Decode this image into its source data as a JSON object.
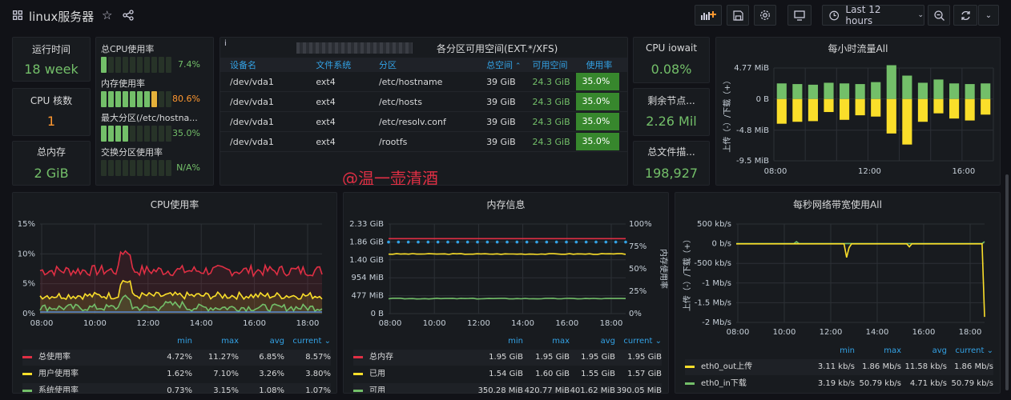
{
  "header": {
    "title": "linux服务器",
    "time_range": "Last 12 hours"
  },
  "stats": {
    "uptime": {
      "title": "运行时间",
      "value": "18 week"
    },
    "cpu_cores": {
      "title": "CPU 核数",
      "value": "1"
    },
    "total_mem": {
      "title": "总内存",
      "value": "2 GiB"
    },
    "iowait": {
      "title": "CPU iowait",
      "value": "0.08%"
    },
    "free_inodes": {
      "title": "剩余节点...",
      "value": "2.26 Mil"
    },
    "total_fd": {
      "title": "总文件描...",
      "value": "198,927"
    }
  },
  "gauges": [
    {
      "label": "总CPU使用率",
      "value": "7.4%",
      "fraction": 0.074,
      "color": "#73bf69"
    },
    {
      "label": "内存使用率",
      "value": "80.6%",
      "fraction": 0.806,
      "color": "#ff9830"
    },
    {
      "label": "最大分区(/etc/hostna...",
      "value": "35.0%",
      "fraction": 0.35,
      "color": "#73bf69"
    },
    {
      "label": "交换分区使用率",
      "value": "N/A%",
      "fraction": 0,
      "color": "#73bf69"
    }
  ],
  "partition_table": {
    "title": "各分区可用空间(EXT.*/XFS)",
    "columns": [
      "设备名",
      "文件系统",
      "分区",
      "总空间",
      "可用空间",
      "使用率"
    ],
    "rows": [
      [
        "/dev/vda1",
        "ext4",
        "/etc/hostname",
        "39 GiB",
        "24.3 GiB",
        "35.0%"
      ],
      [
        "/dev/vda1",
        "ext4",
        "/etc/hosts",
        "39 GiB",
        "24.3 GiB",
        "35.0%"
      ],
      [
        "/dev/vda1",
        "ext4",
        "/etc/resolv.conf",
        "39 GiB",
        "24.3 GiB",
        "35.0%"
      ],
      [
        "/dev/vda1",
        "ext4",
        "/rootfs",
        "39 GiB",
        "24.3 GiB",
        "35.0%"
      ]
    ]
  },
  "watermark": "@温一壶清酒",
  "chart_data": [
    {
      "type": "bar",
      "title": "每小时流量All",
      "ylabel": "上传（-）/下载（+）",
      "y_ticks": [
        "4.77 MiB",
        "0 B",
        "-4.8 MiB",
        "-9.5 MiB"
      ],
      "x_ticks": [
        "08:00",
        "12:00",
        "16:00"
      ],
      "ylim": [
        -9.5,
        4.77
      ],
      "series": [
        {
          "values": [
            2.4,
            2.3,
            2.2,
            2.5,
            2.4,
            2.3,
            2.6,
            5.2,
            3.6,
            2.5,
            3.0,
            2.4,
            2.3,
            2.4
          ],
          "color": "#73bf69"
        },
        {
          "values": [
            -3.8,
            -3.5,
            -3.4,
            -2.0,
            -3.2,
            -2.5,
            -2.7,
            -5.3,
            -7.0,
            -3.5,
            -2.2,
            -3.0,
            -3.3,
            -2.4
          ],
          "color": "#fade2a"
        }
      ]
    },
    {
      "type": "line",
      "title": "CPU使用率",
      "y_ticks": [
        "15%",
        "10%",
        "5%",
        "0%"
      ],
      "ylim": [
        0,
        15
      ],
      "x_ticks": [
        "08:00",
        "10:00",
        "12:00",
        "14:00",
        "16:00",
        "18:00"
      ],
      "series": [
        {
          "name": "总使用率",
          "color": "#e02f44",
          "min": "4.72%",
          "max": "11.27%",
          "avg": "6.85%",
          "current": "8.57%"
        },
        {
          "name": "用户使用率",
          "color": "#fade2a",
          "min": "1.62%",
          "max": "7.10%",
          "avg": "3.26%",
          "current": "3.80%"
        },
        {
          "name": "系统使用率",
          "color": "#73bf69",
          "min": "0.73%",
          "max": "3.15%",
          "avg": "1.08%",
          "current": "1.07%"
        }
      ],
      "legend_headers": [
        "min",
        "max",
        "avg",
        "current"
      ]
    },
    {
      "type": "line",
      "title": "内存信息",
      "y_ticks": [
        "2.33 GiB",
        "1.86 GiB",
        "1.40 GiB",
        "954 MiB",
        "477 MiB",
        "0 B"
      ],
      "y2_ticks": [
        "100%",
        "75%",
        "50%",
        "25%",
        "0%"
      ],
      "y2label": "内存使用率",
      "x_ticks": [
        "08:00",
        "10:00",
        "12:00",
        "14:00",
        "16:00",
        "18:00"
      ],
      "series": [
        {
          "name": "总内存",
          "color": "#e02f44",
          "min": "1.95 GiB",
          "max": "1.95 GiB",
          "avg": "1.95 GiB",
          "current": "1.95 GiB"
        },
        {
          "name": "已用",
          "color": "#fade2a",
          "min": "1.54 GiB",
          "max": "1.60 GiB",
          "avg": "1.55 GiB",
          "current": "1.57 GiB"
        },
        {
          "name": "可用",
          "color": "#73bf69",
          "min": "350.28 MiB",
          "max": "420.77 MiB",
          "avg": "401.62 MiB",
          "current": "390.05 MiB"
        }
      ],
      "legend_headers": [
        "min",
        "max",
        "avg",
        "current"
      ]
    },
    {
      "type": "line",
      "title": "每秒网络带宽使用All",
      "ylabel": "上传（-）/下载（+）",
      "y_ticks": [
        "500 kb/s",
        "0 b/s",
        "-500 kb/s",
        "-1 Mb/s",
        "-1.5 Mb/s",
        "-2 Mb/s"
      ],
      "x_ticks": [
        "08:00",
        "10:00",
        "12:00",
        "14:00",
        "16:00",
        "18:00"
      ],
      "series": [
        {
          "name": "eth0_out上传",
          "color": "#fade2a",
          "min": "3.11 kb/s",
          "max": "1.86 Mb/s",
          "avg": "11.58 kb/s",
          "current": "1.86 Mb/s"
        },
        {
          "name": "eth0_in下载",
          "color": "#73bf69",
          "min": "3.19 kb/s",
          "max": "50.79 kb/s",
          "avg": "4.71 kb/s",
          "current": "50.79 kb/s"
        }
      ],
      "legend_headers": [
        "min",
        "max",
        "avg",
        "current"
      ]
    }
  ]
}
